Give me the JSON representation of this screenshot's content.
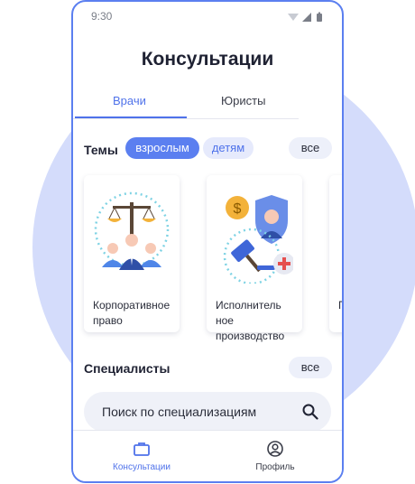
{
  "status_bar": {
    "time": "9:30"
  },
  "header": {
    "title": "Консультации"
  },
  "tabs": [
    {
      "label": "Врачи",
      "active": true
    },
    {
      "label": "Юристы",
      "active": false
    }
  ],
  "topics": {
    "label": "Темы",
    "filters": [
      {
        "label": "взрослым",
        "active": true
      },
      {
        "label": "детям",
        "active": false
      }
    ],
    "all_label": "все",
    "cards": [
      {
        "label": "Корпоративное право",
        "icon": "scales-team-icon"
      },
      {
        "label": "Исполнитель ное производство",
        "icon": "gavel-shield-icon"
      },
      {
        "label": "П п",
        "icon": "card-icon"
      }
    ]
  },
  "specialists": {
    "label": "Специалисты",
    "all_label": "все"
  },
  "search": {
    "placeholder": "Поиск по специализациям",
    "icon": "search-icon"
  },
  "bottom_nav": [
    {
      "label": "Консультации",
      "icon": "briefcase-icon",
      "active": true
    },
    {
      "label": "Профиль",
      "icon": "profile-icon",
      "active": false
    }
  ],
  "colors": {
    "accent": "#5b7ff0",
    "circle_bg": "#d4dcfb",
    "text_dark": "#1f2233"
  }
}
